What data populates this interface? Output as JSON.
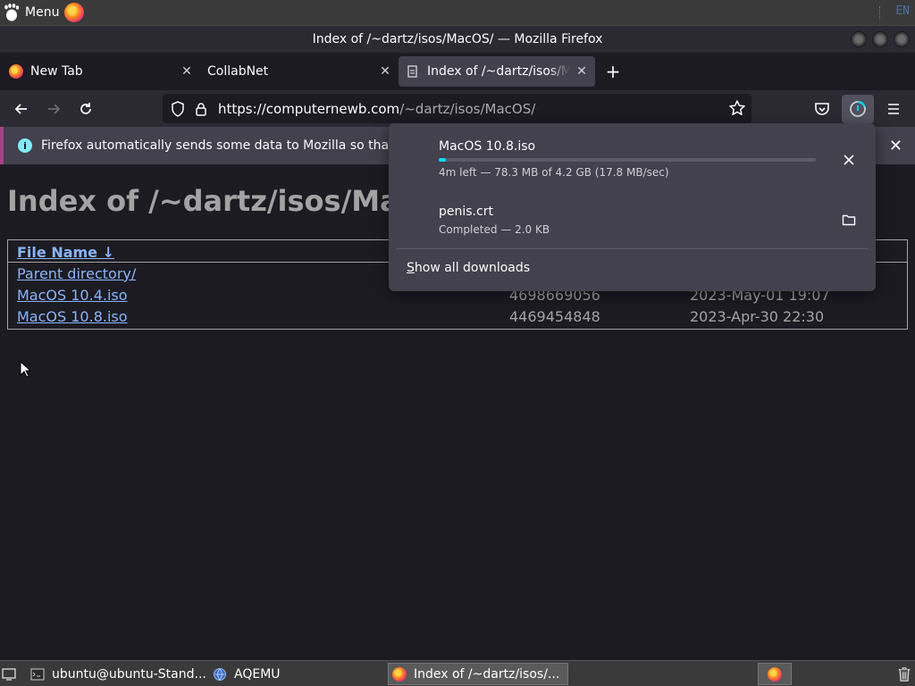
{
  "system_panel": {
    "menu_label": "Menu",
    "language": "EN"
  },
  "window": {
    "title": "Index of /~dartz/isos/MacOS/ — Mozilla Firefox"
  },
  "tabs": [
    {
      "label": "New Tab",
      "icon": "firefox-icon"
    },
    {
      "label": "CollabNet",
      "icon": "none"
    },
    {
      "label": "Index of /~dartz/isos/MacOS/",
      "icon": "page-icon",
      "active": true
    }
  ],
  "toolbar": {
    "url_host": "https://computernewb.com",
    "url_path": "/~dartz/isos/MacOS/"
  },
  "notification": {
    "text": "Firefox automatically sends some data to Mozilla so that we"
  },
  "page": {
    "heading": "Index of /~dartz/isos/MacOS/",
    "column_header": "File Name  ↓ ",
    "rows": [
      {
        "name": "Parent directory/",
        "size": "",
        "date": ""
      },
      {
        "name": "MacOS 10.4.iso",
        "size": "4698669056",
        "date": "2023-May-01 19:07"
      },
      {
        "name": "MacOS 10.8.iso",
        "size": "4469454848",
        "date": "2023-Apr-30 22:30"
      }
    ]
  },
  "downloads": {
    "items": [
      {
        "name": "MacOS 10.8.iso",
        "status": "4m left — 78.3 MB of 4.2 GB (17.8 MB/sec)",
        "progress": 0.019,
        "action": "cancel-icon"
      },
      {
        "name": "penis.crt",
        "status": "Completed — 2.0 KB",
        "action": "folder-icon"
      }
    ],
    "show_all_first": "S",
    "show_all_rest": "how all downloads"
  },
  "taskbar": {
    "tasks": [
      {
        "label": "ubuntu@ubuntu-Stand...",
        "icon": "terminal-icon"
      },
      {
        "label": "AQEMU",
        "icon": "qemu-icon"
      },
      {
        "label": "Index of /~dartz/isos/...",
        "icon": "firefox-icon",
        "active": true
      }
    ]
  },
  "colors": {
    "accent": "#00ddff",
    "link": "#8ab4f8",
    "panel": "#42414d"
  }
}
